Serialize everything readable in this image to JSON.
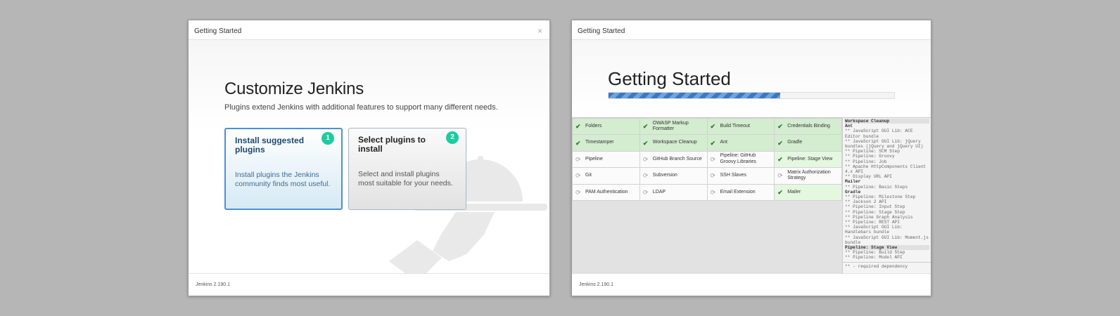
{
  "left_dialog": {
    "header_title": "Getting Started",
    "close_icon": "×",
    "heading": "Customize Jenkins",
    "subtitle": "Plugins extend Jenkins with additional features to support many different needs.",
    "options": [
      {
        "number": "1",
        "title": "Install suggested plugins",
        "description": "Install plugins the Jenkins community finds most useful."
      },
      {
        "number": "2",
        "title": "Select plugins to install",
        "description": "Select and install plugins most suitable for your needs."
      }
    ],
    "footer_version": "Jenkins 2.190.1"
  },
  "right_dialog": {
    "header_title": "Getting Started",
    "heading": "Getting Started",
    "progress_fraction": 0.6,
    "plugins": [
      [
        {
          "name": "Folders",
          "status": "success"
        },
        {
          "name": "OWASP Markup Formatter",
          "status": "success"
        },
        {
          "name": "Build Timeout",
          "status": "success"
        },
        {
          "name": "Credentials Binding",
          "status": "success"
        }
      ],
      [
        {
          "name": "Timestamper",
          "status": "success"
        },
        {
          "name": "Workspace Cleanup",
          "status": "success"
        },
        {
          "name": "Ant",
          "status": "success"
        },
        {
          "name": "Gradle",
          "status": "success"
        }
      ],
      [
        {
          "name": "Pipeline",
          "status": "pending"
        },
        {
          "name": "GitHub Branch Source",
          "status": "pending"
        },
        {
          "name": "Pipeline: GitHub Groovy Libraries",
          "status": "pending"
        },
        {
          "name": "Pipeline: Stage View",
          "status": "success"
        }
      ],
      [
        {
          "name": "Git",
          "status": "pending"
        },
        {
          "name": "Subversion",
          "status": "pending"
        },
        {
          "name": "SSH Slaves",
          "status": "pending"
        },
        {
          "name": "Matrix Authorization Strategy",
          "status": "pending"
        }
      ],
      [
        {
          "name": "PAM Authentication",
          "status": "pending"
        },
        {
          "name": "LDAP",
          "status": "pending"
        },
        {
          "name": "Email Extension",
          "status": "pending"
        },
        {
          "name": "Mailer",
          "status": "success"
        }
      ]
    ],
    "install_log": [
      {
        "text": "Workspace Cleanup",
        "style": "hbar"
      },
      {
        "text": "Ant",
        "style": "h"
      },
      {
        "text": "** JavaScript GUI Lib: ACE Editor bundle",
        "style": ""
      },
      {
        "text": "** JavaScript GUI Lib: jQuery bundles (jQuery and jQuery UI)",
        "style": ""
      },
      {
        "text": "** Pipeline: SCM Step",
        "style": ""
      },
      {
        "text": "** Pipeline: Groovy",
        "style": ""
      },
      {
        "text": "** Pipeline: Job",
        "style": ""
      },
      {
        "text": "** Apache HttpComponents Client 4.x API",
        "style": ""
      },
      {
        "text": "** Display URL API",
        "style": ""
      },
      {
        "text": "Mailer",
        "style": "h"
      },
      {
        "text": "** Pipeline: Basic Steps",
        "style": ""
      },
      {
        "text": "Gradle",
        "style": "h"
      },
      {
        "text": "** Pipeline: Milestone Step",
        "style": ""
      },
      {
        "text": "** Jackson 2 API",
        "style": ""
      },
      {
        "text": "** Pipeline: Input Step",
        "style": ""
      },
      {
        "text": "** Pipeline: Stage Step",
        "style": ""
      },
      {
        "text": "** Pipeline Graph Analysis",
        "style": ""
      },
      {
        "text": "** Pipeline: REST API",
        "style": ""
      },
      {
        "text": "** JavaScript GUI Lib: Handlebars bundle",
        "style": ""
      },
      {
        "text": "** JavaScript GUI Lib: Moment.js bundle",
        "style": ""
      },
      {
        "text": "Pipeline: Stage View",
        "style": "hbar"
      },
      {
        "text": "** Pipeline: Build Step",
        "style": ""
      },
      {
        "text": "** Pipeline: Model API",
        "style": ""
      }
    ],
    "log_footnote": "** - required dependency",
    "footer_version": "Jenkins 2.190.1"
  },
  "colors": {
    "accent": "#1ecba0",
    "selected_border": "#4a90d9",
    "success_bg": "#d4ecd0",
    "progress": "#3c78c3"
  }
}
